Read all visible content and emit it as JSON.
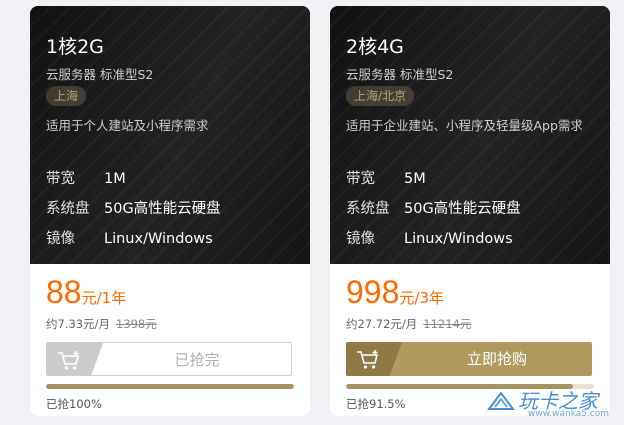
{
  "cards": [
    {
      "title": "1核2G",
      "subtitle": "云服务器 标准型S2",
      "region": "上海",
      "description": "适用于个人建站及小程序需求",
      "specs": [
        {
          "key": "带宽",
          "value": "1M"
        },
        {
          "key": "系统盘",
          "value": "50G高性能云硬盘"
        },
        {
          "key": "镜像",
          "value": "Linux/Windows"
        }
      ],
      "price": "88",
      "price_unit": "元/1年",
      "monthly": "约7.33元/月",
      "original": "1398元",
      "button": "已抢完",
      "button_state": "disabled",
      "progress": 1.0,
      "progress_label": "已抢100%"
    },
    {
      "title": "2核4G",
      "subtitle": "云服务器 标准型S2",
      "region": "上海/北京",
      "description": "适用于企业建站、小程序及轻量级App需求",
      "specs": [
        {
          "key": "带宽",
          "value": "5M"
        },
        {
          "key": "系统盘",
          "value": "50G高性能云硬盘"
        },
        {
          "key": "镜像",
          "value": "Linux/Windows"
        }
      ],
      "price": "998",
      "price_unit": "元/3年",
      "monthly": "约27.72元/月",
      "original": "11214元",
      "button": "立即抢购",
      "button_state": "active",
      "progress": 0.915,
      "progress_label": "已抢91.5%"
    }
  ],
  "watermark": {
    "text": "玩卡之家",
    "url": "www.wanka5.com"
  },
  "colors": {
    "accent": "#ff6a00",
    "gold": "#b09a5e",
    "dark": "#171717"
  }
}
